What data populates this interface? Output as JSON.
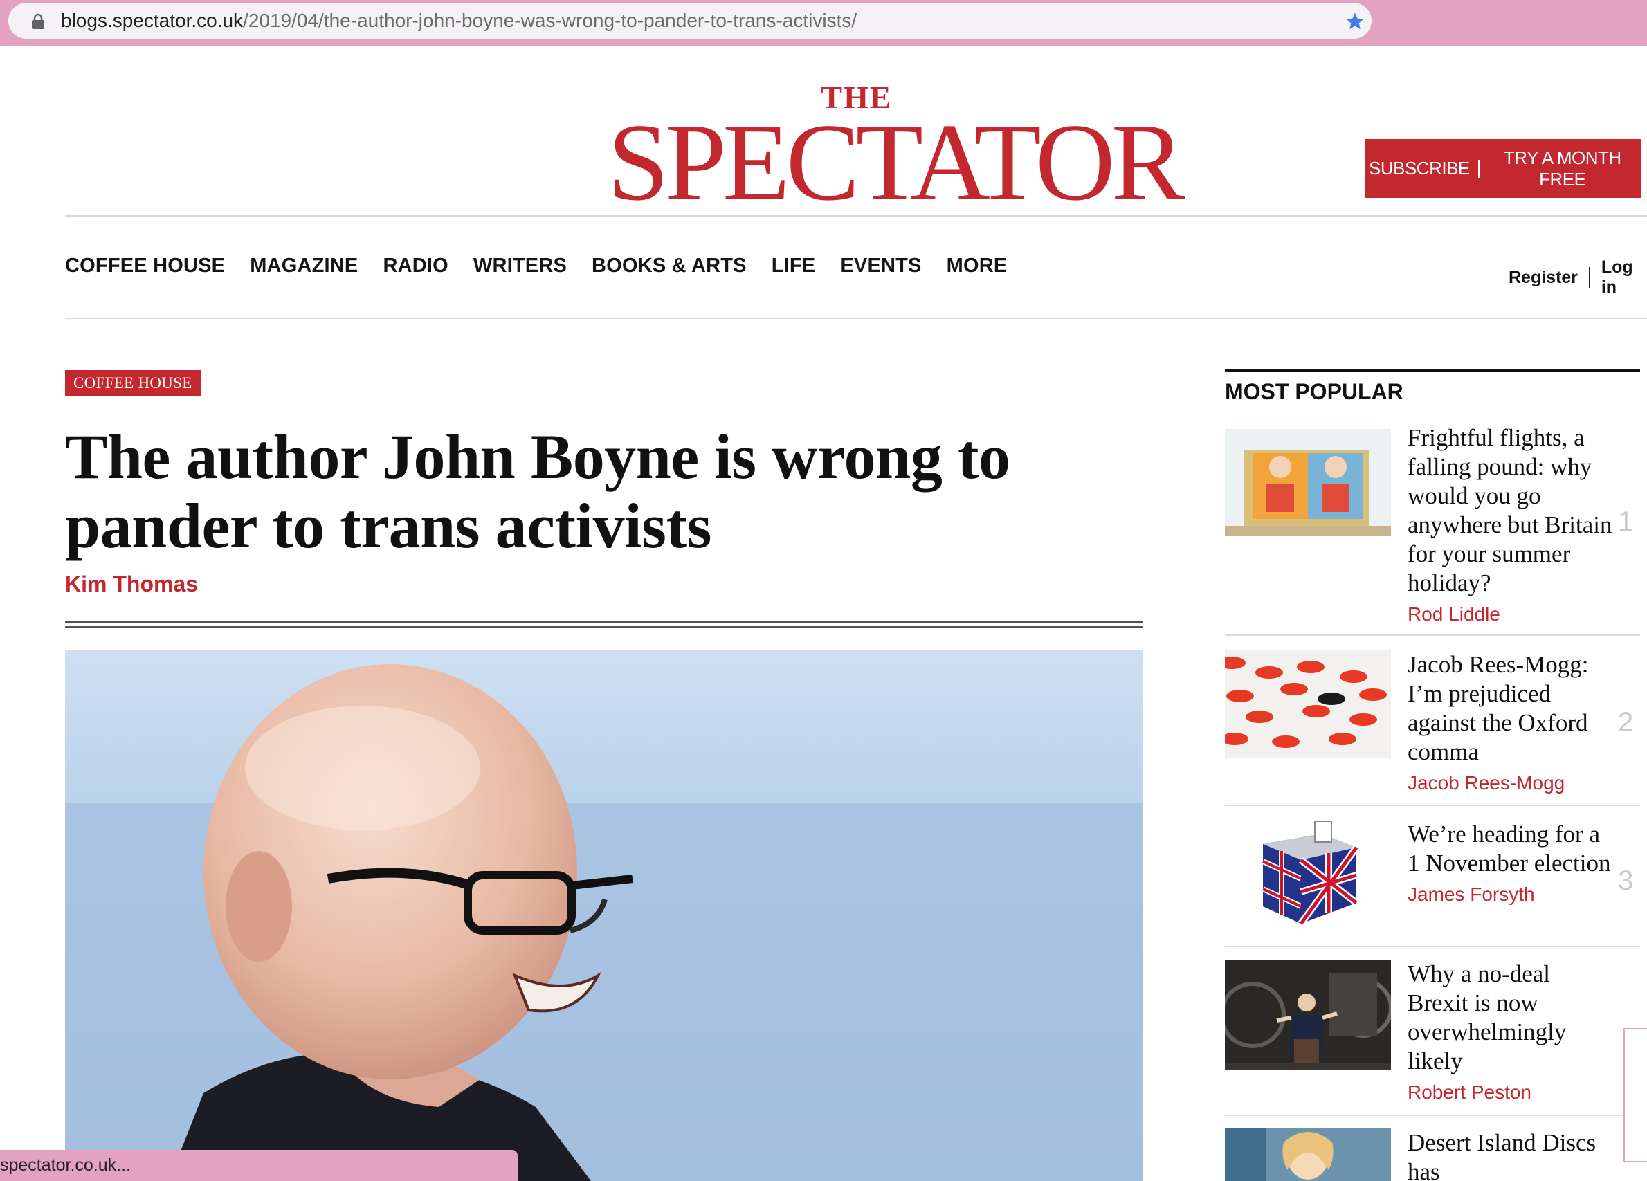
{
  "browser": {
    "url_host": "blogs.spectator.co.uk",
    "url_path": "/2019/04/the-author-john-boyne-was-wrong-to-pander-to-trans-activists/",
    "status_text": "spectator.co.uk..."
  },
  "masthead": {
    "logo_the": "THE",
    "logo_name": "SPECTATOR",
    "subscribe_label": "SUBSCRIBE",
    "trial_label": "TRY A MONTH FREE"
  },
  "nav": {
    "items": [
      "COFFEE HOUSE",
      "MAGAZINE",
      "RADIO",
      "WRITERS",
      "BOOKS & ARTS",
      "LIFE",
      "EVENTS",
      "MORE"
    ],
    "register": "Register",
    "login": "Log in"
  },
  "article": {
    "section_tag": "COFFEE HOUSE",
    "headline": "The author John Boyne is wrong to pander to trans activists",
    "author": "Kim Thomas"
  },
  "most_popular": {
    "title": "MOST POPULAR",
    "items": [
      {
        "headline": "Frightful flights, a falling pound: why would you go anywhere but Britain for your summer holiday?",
        "author": "Rod Liddle",
        "rank": "1"
      },
      {
        "headline": "Jacob Rees-Mogg: I’m prejudiced against the Oxford comma",
        "author": "Jacob Rees-Mogg",
        "rank": "2"
      },
      {
        "headline": "We’re heading for a 1 November election",
        "author": "James Forsyth",
        "rank": "3"
      },
      {
        "headline": "Why a no-deal Brexit is now overwhelmingly likely",
        "author": "Robert Peston",
        "rank": ""
      },
      {
        "headline": "Desert Island Discs has",
        "author": "",
        "rank": ""
      }
    ]
  },
  "colors": {
    "brand_red": "#c3282e",
    "browser_chrome": "#e3a2bf",
    "star_blue": "#3f7ee8"
  }
}
